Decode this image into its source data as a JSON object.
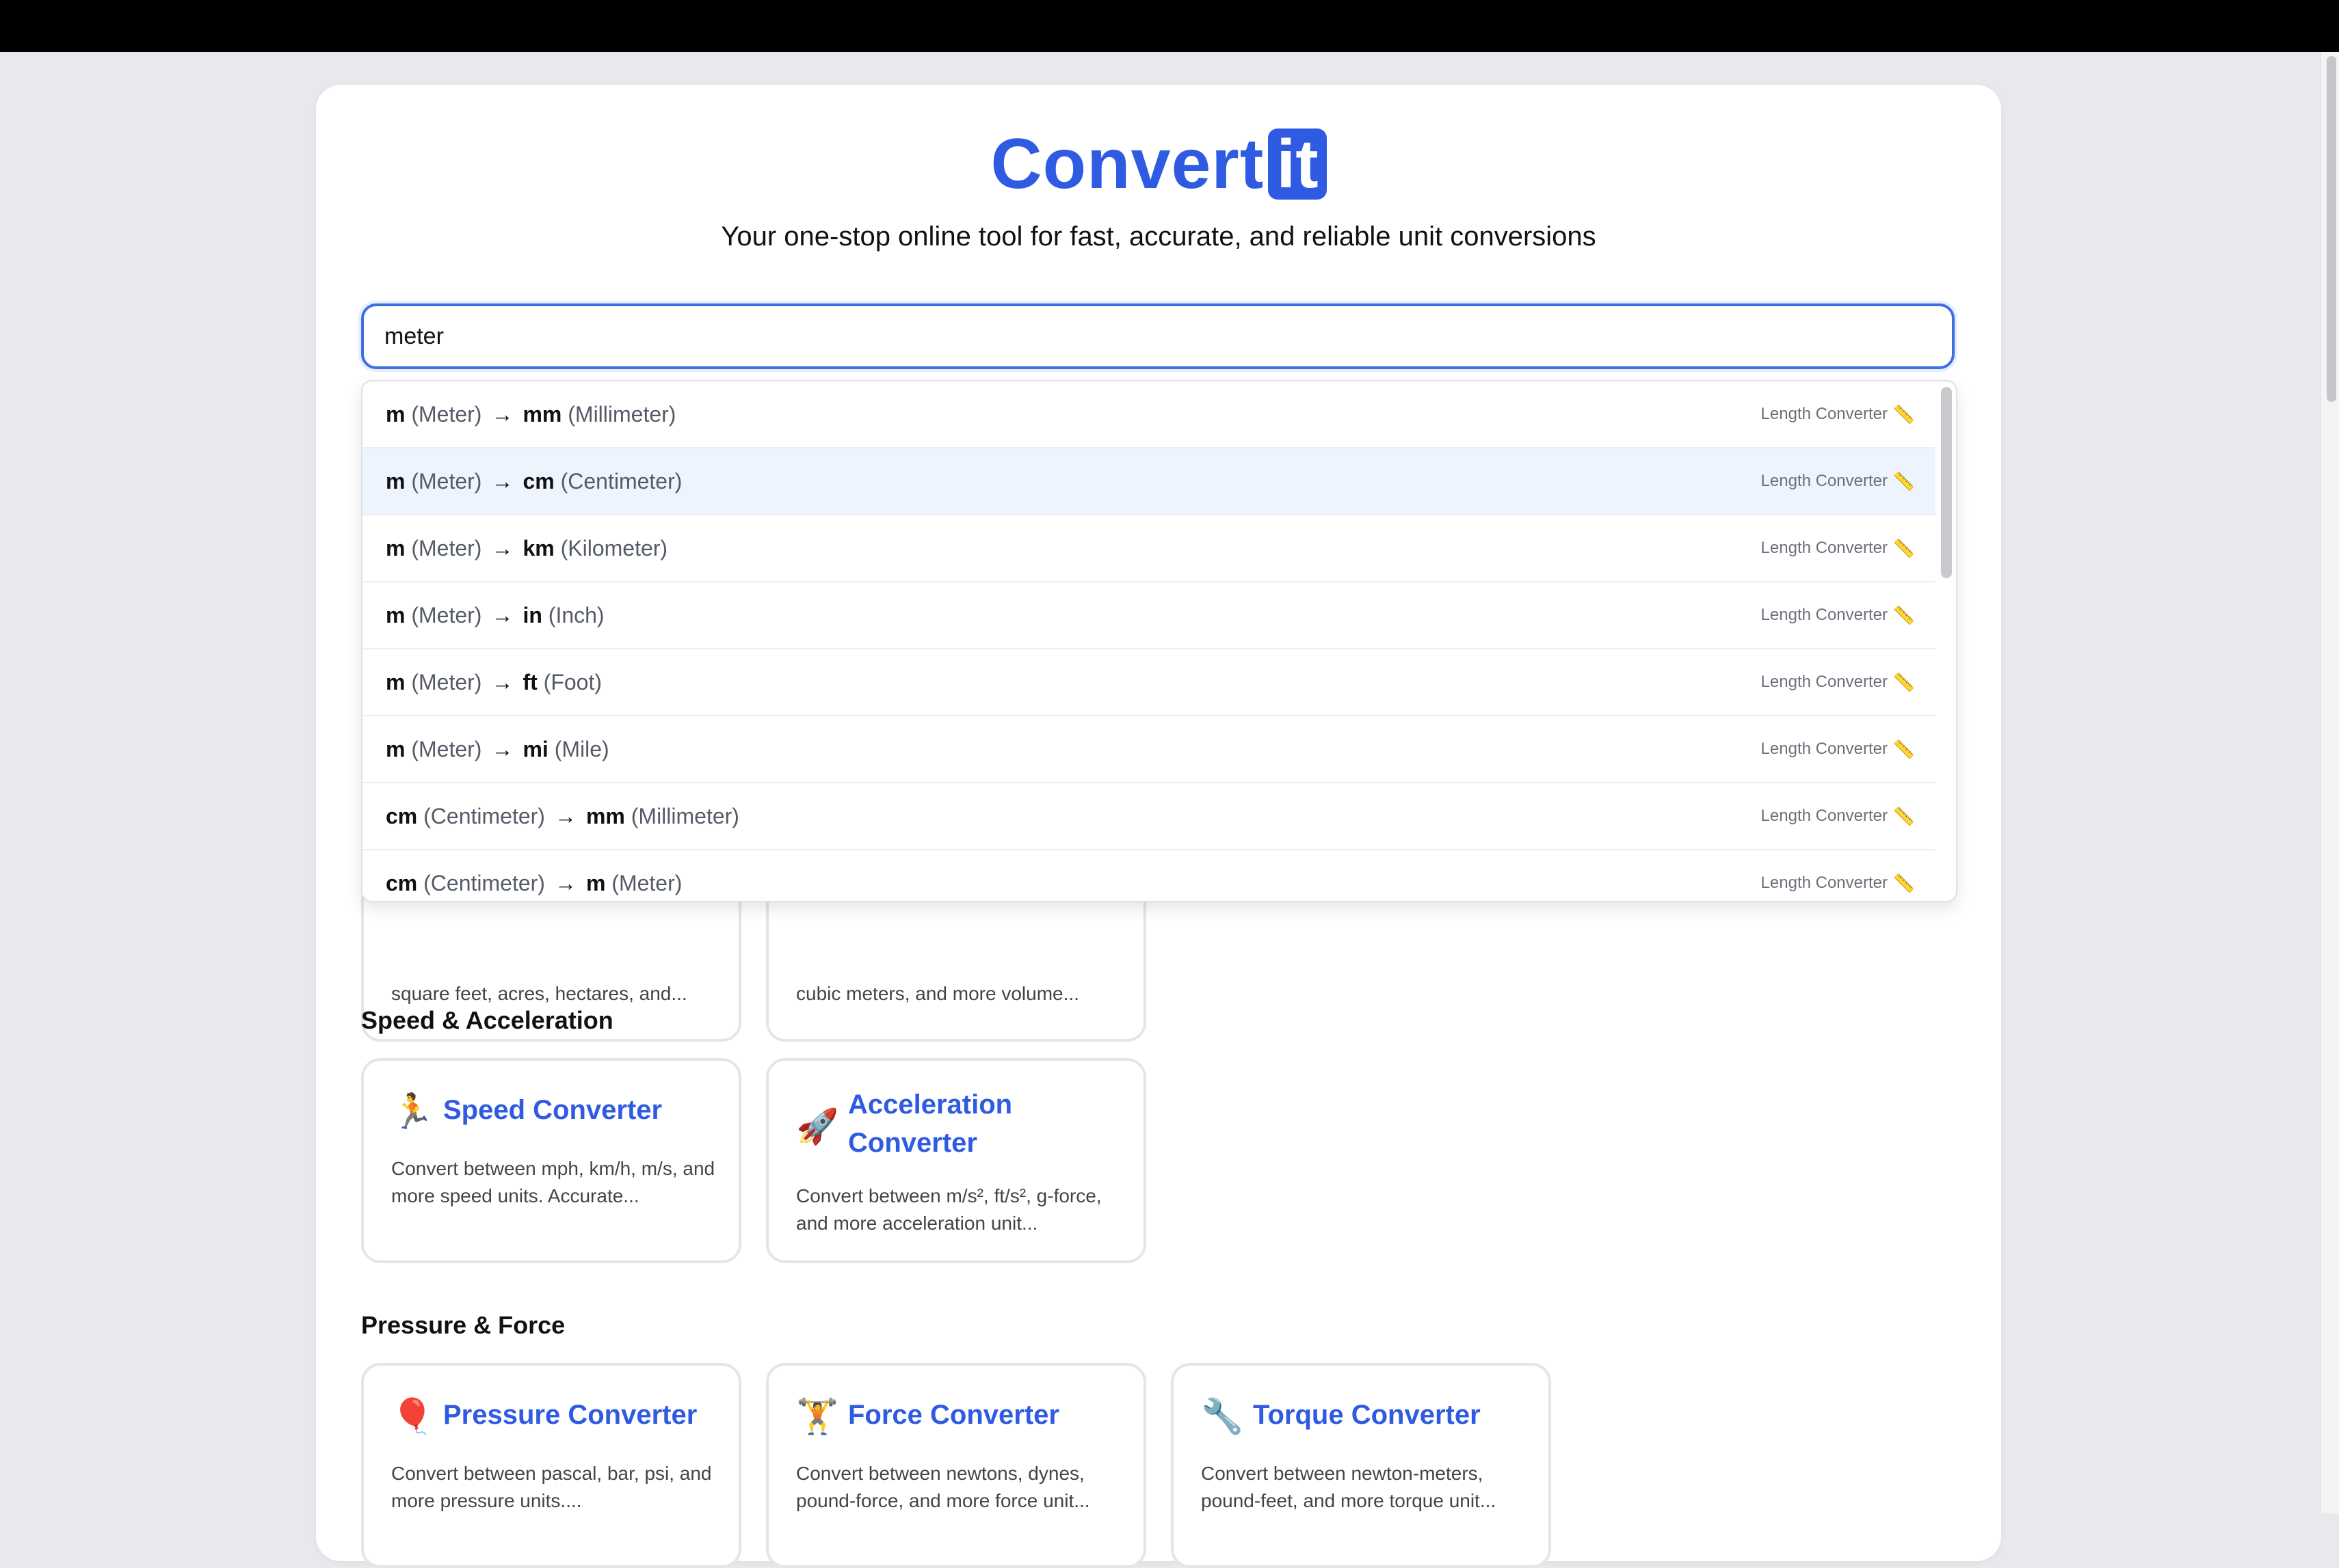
{
  "logo": {
    "text": "Convert",
    "box": "it",
    "color": "#2f5be3"
  },
  "tagline": "Your one-stop online tool for fast, accurate, and reliable unit conversions",
  "search": {
    "value": "meter"
  },
  "dropdown": {
    "items": [
      {
        "from_code": "m",
        "from_name": "(Meter)",
        "to_code": "mm",
        "to_name": "(Millimeter)",
        "category": "Length Converter"
      },
      {
        "from_code": "m",
        "from_name": "(Meter)",
        "to_code": "cm",
        "to_name": "(Centimeter)",
        "category": "Length Converter"
      },
      {
        "from_code": "m",
        "from_name": "(Meter)",
        "to_code": "km",
        "to_name": "(Kilometer)",
        "category": "Length Converter"
      },
      {
        "from_code": "m",
        "from_name": "(Meter)",
        "to_code": "in",
        "to_name": "(Inch)",
        "category": "Length Converter"
      },
      {
        "from_code": "m",
        "from_name": "(Meter)",
        "to_code": "ft",
        "to_name": "(Foot)",
        "category": "Length Converter"
      },
      {
        "from_code": "m",
        "from_name": "(Meter)",
        "to_code": "mi",
        "to_name": "(Mile)",
        "category": "Length Converter"
      },
      {
        "from_code": "cm",
        "from_name": "(Centimeter)",
        "to_code": "mm",
        "to_name": "(Millimeter)",
        "category": "Length Converter"
      },
      {
        "from_code": "cm",
        "from_name": "(Centimeter)",
        "to_code": "m",
        "to_name": "(Meter)",
        "category": "Length Converter"
      }
    ],
    "arrow": "→",
    "icon": "📏"
  },
  "partial_cards": [
    {
      "desc": "square feet, acres, hectares, and..."
    },
    {
      "desc": "cubic meters, and more volume..."
    }
  ],
  "sections": [
    {
      "title": "Speed & Acceleration",
      "cards": [
        {
          "emoji": "🏃",
          "title": "Speed Converter",
          "desc": "Convert between mph, km/h, m/s, and more speed units. Accurate..."
        },
        {
          "emoji": "🚀",
          "title": "Acceleration Converter",
          "desc": "Convert between m/s², ft/s², g-force, and more acceleration unit..."
        }
      ]
    },
    {
      "title": "Pressure & Force",
      "cards": [
        {
          "emoji": "🎈",
          "title": "Pressure Converter",
          "desc": "Convert between pascal, bar, psi, and more pressure units...."
        },
        {
          "emoji": "🏋",
          "title": "Force Converter",
          "desc": "Convert between newtons, dynes, pound-force, and more force unit..."
        },
        {
          "emoji": "🔧",
          "title": "Torque Converter",
          "desc": "Convert between newton-meters, pound-feet, and more torque unit..."
        }
      ]
    }
  ]
}
